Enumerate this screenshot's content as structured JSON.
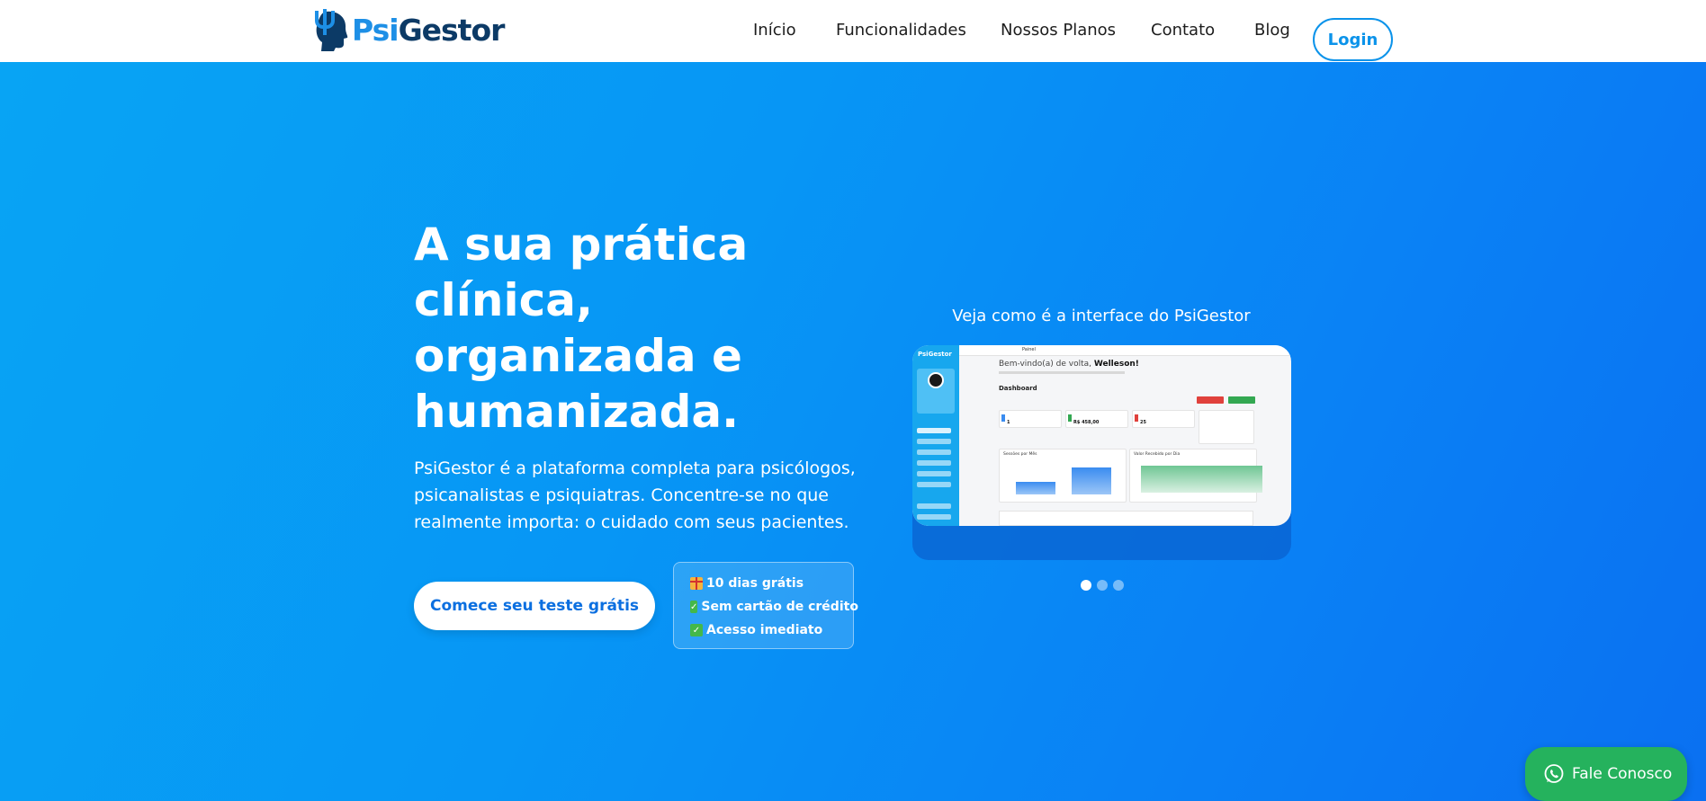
{
  "brand": {
    "name_psi": "Psi",
    "name_gestor": "Gestor"
  },
  "nav": {
    "items": [
      "Início",
      "Funcionalidades",
      "Nossos Planos",
      "Contato",
      "Blog"
    ],
    "login": "Login"
  },
  "hero": {
    "title_lines": [
      "A sua prática",
      "clínica,",
      "organizada e",
      "humanizada."
    ],
    "description_lines": [
      "PsiGestor é a plataforma completa para psicólogos,",
      "psicanalistas e psiquiatras. Concentre-se no que",
      "realmente importa: o cuidado com seus pacientes."
    ],
    "cta": "Comece seu teste grátis",
    "perks": [
      {
        "icon": "gift-icon",
        "text": "10 dias grátis"
      },
      {
        "icon": "check-icon",
        "text": "Sem cartão de crédito"
      },
      {
        "icon": "check-icon",
        "text": "Acesso imediato"
      }
    ]
  },
  "carousel": {
    "caption": "Veja como é a interface do PsiGestor",
    "slide_count": 3,
    "active_slide": 1,
    "mock": {
      "side_logo": "PsiGestor",
      "topbar": "Painel",
      "greeting": "Bem-vindo(a) de volta,",
      "greeting_name": "Welleson!",
      "dashboard": "Dashboard",
      "card_1_value": "1",
      "card_2_value": "R$ 458,00",
      "card_3_value": "25",
      "panel_1_title": "Sessões por Mês",
      "panel_2_title": "Valor Recebido por Dia"
    }
  },
  "whatsapp": {
    "label": "Fale Conosco"
  },
  "colors": {
    "hero_gradient_start": "#08a4f4",
    "hero_gradient_end": "#0a70f1",
    "accent": "#0b93ea",
    "whatsapp": "#25b25d"
  }
}
